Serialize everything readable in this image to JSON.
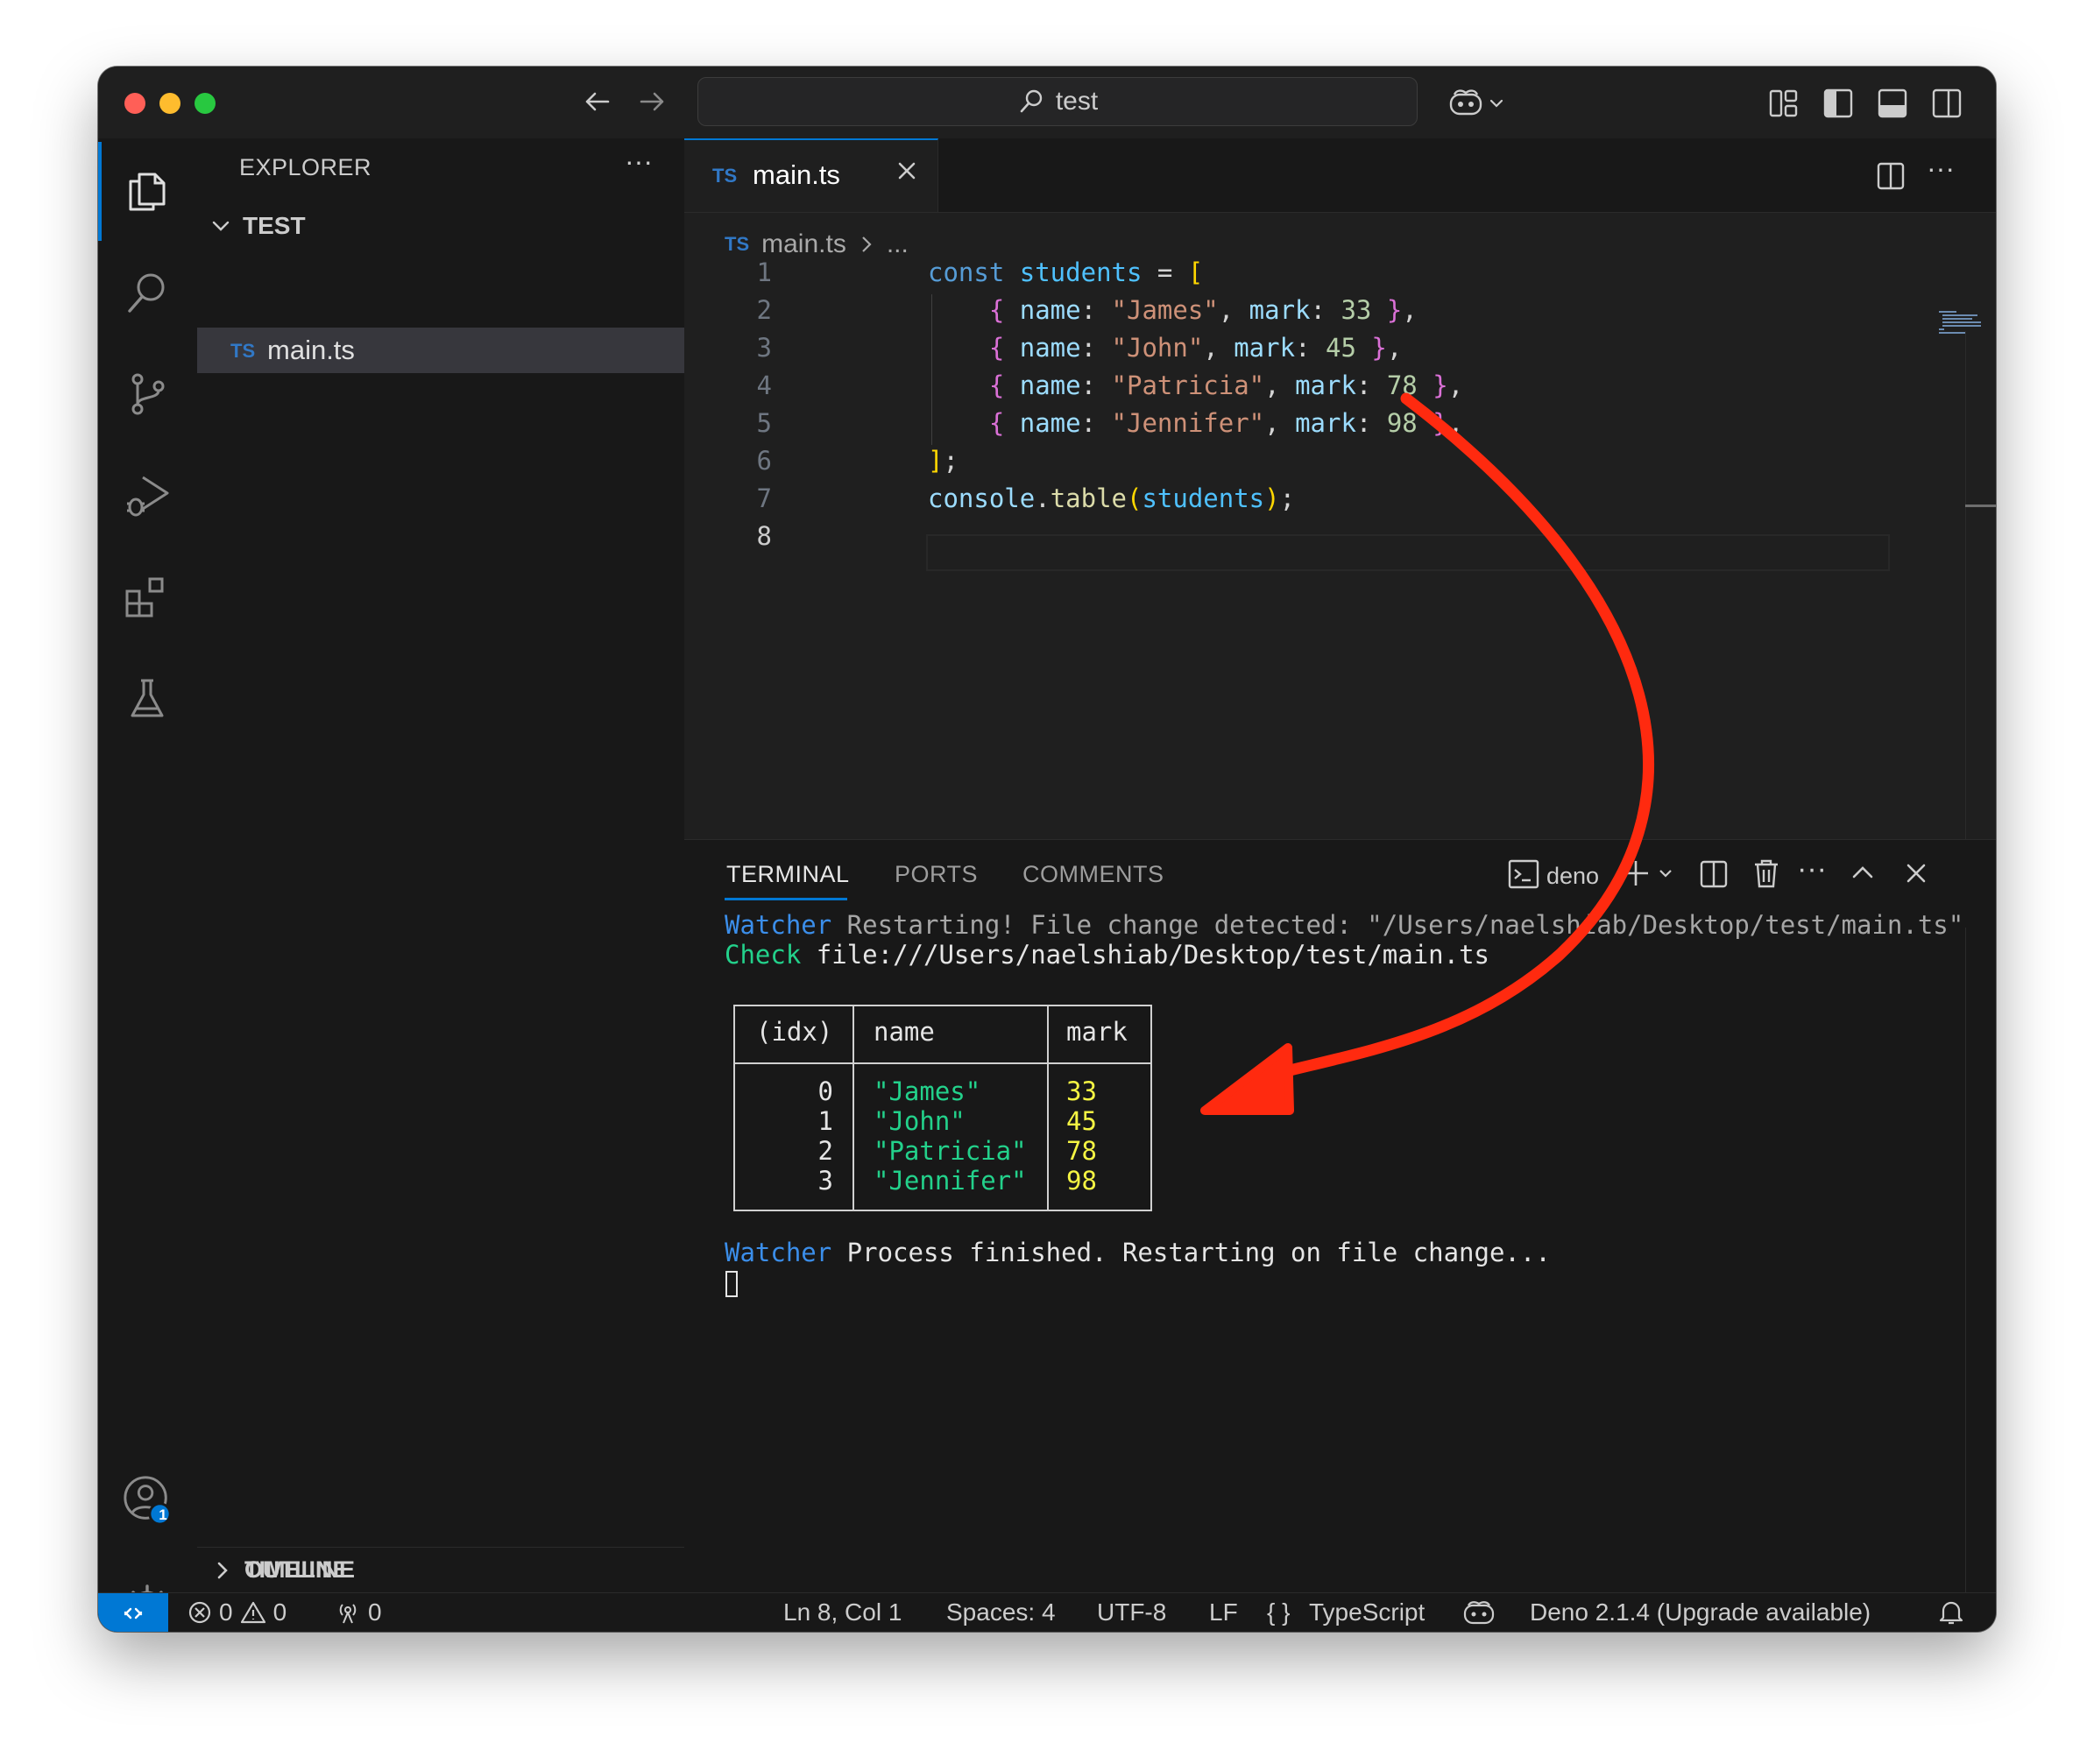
{
  "titlebar": {
    "search_text": "test",
    "traffic_colors": {
      "close": "#ff5f57",
      "minimize": "#febc2e",
      "maximize": "#28c840"
    }
  },
  "sidebar": {
    "title": "EXPLORER",
    "folder": "TEST",
    "files": [
      {
        "name": "main.ts",
        "badge": "TS"
      }
    ],
    "sections": [
      "OUTLINE",
      "TIMELINE"
    ],
    "account_badge": "1"
  },
  "editor": {
    "tab": {
      "label": "main.ts",
      "badge": "TS"
    },
    "breadcrumb": {
      "badge": "TS",
      "file": "main.ts",
      "rest": "..."
    },
    "lines": [
      {
        "n": "1",
        "tokens": [
          [
            "const ",
            "#569cd6"
          ],
          [
            "students",
            "#4fc1ff"
          ],
          [
            " = ",
            "#d4d4d4"
          ],
          [
            "[",
            "#ffd700"
          ]
        ]
      },
      {
        "n": "2",
        "tokens": [
          [
            "    ",
            "#d4d4d4"
          ],
          [
            "{ ",
            "#da70d6"
          ],
          [
            "name",
            "#9cdcfe"
          ],
          [
            ": ",
            "#d4d4d4"
          ],
          [
            "\"James\"",
            "#ce9178"
          ],
          [
            ", ",
            "#d4d4d4"
          ],
          [
            "mark",
            "#9cdcfe"
          ],
          [
            ": ",
            "#d4d4d4"
          ],
          [
            "33",
            "#b5cea8"
          ],
          [
            " ",
            "#d4d4d4"
          ],
          [
            "}",
            "#da70d6"
          ],
          [
            ",",
            "#d4d4d4"
          ]
        ]
      },
      {
        "n": "3",
        "tokens": [
          [
            "    ",
            "#d4d4d4"
          ],
          [
            "{ ",
            "#da70d6"
          ],
          [
            "name",
            "#9cdcfe"
          ],
          [
            ": ",
            "#d4d4d4"
          ],
          [
            "\"John\"",
            "#ce9178"
          ],
          [
            ", ",
            "#d4d4d4"
          ],
          [
            "mark",
            "#9cdcfe"
          ],
          [
            ": ",
            "#d4d4d4"
          ],
          [
            "45",
            "#b5cea8"
          ],
          [
            " ",
            "#d4d4d4"
          ],
          [
            "}",
            "#da70d6"
          ],
          [
            ",",
            "#d4d4d4"
          ]
        ]
      },
      {
        "n": "4",
        "tokens": [
          [
            "    ",
            "#d4d4d4"
          ],
          [
            "{ ",
            "#da70d6"
          ],
          [
            "name",
            "#9cdcfe"
          ],
          [
            ": ",
            "#d4d4d4"
          ],
          [
            "\"Patricia\"",
            "#ce9178"
          ],
          [
            ", ",
            "#d4d4d4"
          ],
          [
            "mark",
            "#9cdcfe"
          ],
          [
            ": ",
            "#d4d4d4"
          ],
          [
            "78",
            "#b5cea8"
          ],
          [
            " ",
            "#d4d4d4"
          ],
          [
            "}",
            "#da70d6"
          ],
          [
            ",",
            "#d4d4d4"
          ]
        ]
      },
      {
        "n": "5",
        "tokens": [
          [
            "    ",
            "#d4d4d4"
          ],
          [
            "{ ",
            "#da70d6"
          ],
          [
            "name",
            "#9cdcfe"
          ],
          [
            ": ",
            "#d4d4d4"
          ],
          [
            "\"Jennifer\"",
            "#ce9178"
          ],
          [
            ", ",
            "#d4d4d4"
          ],
          [
            "mark",
            "#9cdcfe"
          ],
          [
            ": ",
            "#d4d4d4"
          ],
          [
            "98",
            "#b5cea8"
          ],
          [
            " ",
            "#d4d4d4"
          ],
          [
            "}",
            "#da70d6"
          ],
          [
            ",",
            "#d4d4d4"
          ]
        ]
      },
      {
        "n": "6",
        "tokens": [
          [
            "]",
            "#ffd700"
          ],
          [
            ";",
            "#d4d4d4"
          ]
        ]
      },
      {
        "n": "7",
        "tokens": [
          [
            "console",
            "#9cdcfe"
          ],
          [
            ".",
            "#d4d4d4"
          ],
          [
            "table",
            "#dcdcaa"
          ],
          [
            "(",
            "#ffd700"
          ],
          [
            "students",
            "#4fc1ff"
          ],
          [
            ")",
            "#ffd700"
          ],
          [
            ";",
            "#d4d4d4"
          ]
        ]
      },
      {
        "n": "8",
        "tokens": []
      }
    ]
  },
  "panel": {
    "tabs": [
      "TERMINAL",
      "PORTS",
      "COMMENTS"
    ],
    "shell_label": "deno",
    "terminal": {
      "line1": {
        "tag": "Watcher",
        "text": " Restarting! File change detected: \"/Users/naelshiab/Desktop/test/main.ts\""
      },
      "line2": {
        "tag": "Check",
        "text": " file:///Users/naelshiab/Desktop/test/main.ts"
      },
      "table": {
        "headers": [
          "(idx)",
          "name",
          "mark"
        ],
        "rows": [
          {
            "idx": "0",
            "name": "\"James\"",
            "mark": "33"
          },
          {
            "idx": "1",
            "name": "\"John\"",
            "mark": "45"
          },
          {
            "idx": "2",
            "name": "\"Patricia\"",
            "mark": "78"
          },
          {
            "idx": "3",
            "name": "\"Jennifer\"",
            "mark": "98"
          }
        ]
      },
      "line3": {
        "tag": "Watcher",
        "text": " Process finished. Restarting on file change..."
      }
    }
  },
  "statusbar": {
    "errors": "0",
    "warnings": "0",
    "ports": "0",
    "position": "Ln 8, Col 1",
    "spaces": "Spaces: 4",
    "encoding": "UTF-8",
    "eol": "LF",
    "language": "TypeScript",
    "runtime": "Deno 2.1.4 (Upgrade available)"
  },
  "colors": {
    "accent": "#0078d4",
    "annotation_arrow": "#ff2a0f",
    "terminal_blue": "#3b8eea",
    "terminal_green": "#23d18b",
    "terminal_yellow": "#f5f543"
  }
}
